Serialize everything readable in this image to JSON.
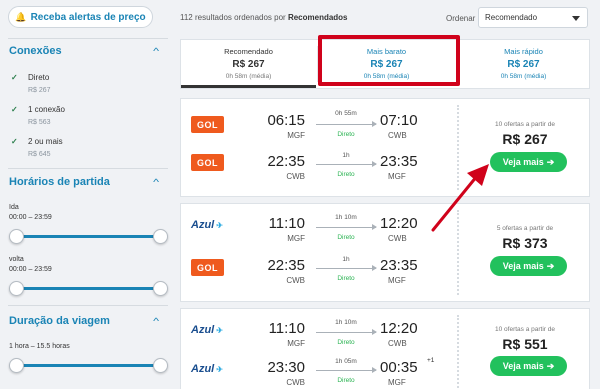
{
  "alerts_button": {
    "label": "Receba alertas de preço",
    "icon": "bell-icon"
  },
  "results": {
    "count_text": "112 resultados ordenados por ",
    "order_bold": "Recomendados"
  },
  "order": {
    "label": "Ordenar",
    "selected": "Recomendado"
  },
  "filters": {
    "connections": {
      "title": "Conexões",
      "options": [
        {
          "label": "Direto",
          "price": "R$ 267",
          "checked": true
        },
        {
          "label": "1 conexão",
          "price": "R$ 563",
          "checked": true
        },
        {
          "label": "2 ou mais",
          "price": "R$ 645",
          "checked": true
        }
      ]
    },
    "departure": {
      "title": "Horários de partida",
      "ida_label": "Ida",
      "ida_range": "00:00 – 23:59",
      "volta_label": "volta",
      "volta_range": "00:00 – 23:59"
    },
    "duration": {
      "title": "Duração da viagem",
      "range": "1 hora – 15.5 horas"
    }
  },
  "tabs": [
    {
      "name": "Recomendado",
      "price": "R$ 267",
      "duration": "0h 58m (média)"
    },
    {
      "name": "Mais barato",
      "price": "R$ 267",
      "duration": "0h 58m (média)"
    },
    {
      "name": "Mais rápido",
      "price": "R$ 267",
      "duration": "0h 58m (média)"
    }
  ],
  "cards": [
    {
      "legs": [
        {
          "airline": "GOL",
          "dep_time": "06:15",
          "dep_code": "MGF",
          "duration": "0h 55m",
          "stops": "Direto",
          "arr_time": "07:10",
          "arr_code": "CWB",
          "plus": ""
        },
        {
          "airline": "GOL",
          "dep_time": "22:35",
          "dep_code": "CWB",
          "duration": "1h",
          "stops": "Direto",
          "arr_time": "23:35",
          "arr_code": "MGF",
          "plus": ""
        }
      ],
      "offers": "10 ofertas a partir de",
      "price": "R$ 267",
      "button": "Veja mais"
    },
    {
      "legs": [
        {
          "airline": "Azul",
          "dep_time": "11:10",
          "dep_code": "MGF",
          "duration": "1h 10m",
          "stops": "Direto",
          "arr_time": "12:20",
          "arr_code": "CWB",
          "plus": ""
        },
        {
          "airline": "GOL",
          "dep_time": "22:35",
          "dep_code": "CWB",
          "duration": "1h",
          "stops": "Direto",
          "arr_time": "23:35",
          "arr_code": "MGF",
          "plus": ""
        }
      ],
      "offers": "5 ofertas a partir de",
      "price": "R$ 373",
      "button": "Veja mais"
    },
    {
      "legs": [
        {
          "airline": "Azul",
          "dep_time": "11:10",
          "dep_code": "MGF",
          "duration": "1h 10m",
          "stops": "Direto",
          "arr_time": "12:20",
          "arr_code": "CWB",
          "plus": ""
        },
        {
          "airline": "Azul",
          "dep_time": "23:30",
          "dep_code": "CWB",
          "duration": "1h 05m",
          "stops": "Direto",
          "arr_time": "00:35",
          "arr_code": "MGF",
          "plus": "+1"
        }
      ],
      "offers": "10 ofertas a partir de",
      "price": "R$ 551",
      "button": "Veja mais"
    }
  ],
  "colors": {
    "accent": "#1a84b5",
    "cta": "#22c15d",
    "highlight": "#d0021b",
    "gol": "#ef5a1e",
    "azul": "#1a4e8f"
  }
}
